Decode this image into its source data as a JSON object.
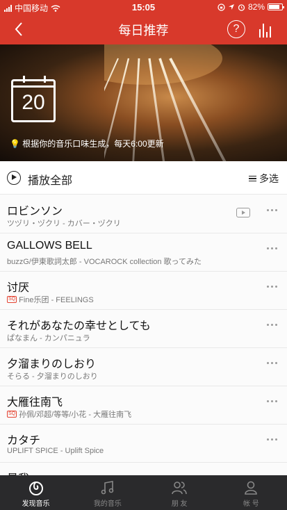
{
  "status": {
    "carrier": "中国移动",
    "time": "15:05",
    "battery": "82%"
  },
  "header": {
    "title": "每日推荐"
  },
  "hero": {
    "day": "20",
    "hint": "根据你的音乐口味生成，每天6:00更新"
  },
  "toolbar": {
    "play_all": "播放全部",
    "multi_select": "多选"
  },
  "songs": [
    {
      "title": "ロビンソン",
      "subtitle": "ツヅリ・ヅクリ - カバー・ヅクリ",
      "sq": false,
      "mv": true
    },
    {
      "title": "GALLOWS BELL",
      "subtitle": "buzzG/伊東歌詞太郎 - VOCAROCK collection 歌ってみた",
      "sq": false,
      "mv": false
    },
    {
      "title": "讨厌",
      "subtitle": "Fine乐团 - FEELINGS",
      "sq": true,
      "mv": false
    },
    {
      "title": "それがあなたの幸せとしても",
      "subtitle": "ぱなまん - カンパニュラ",
      "sq": false,
      "mv": false
    },
    {
      "title": "夕溜まりのしおり",
      "subtitle": "そらる - 夕溜まりのしおり",
      "sq": false,
      "mv": false
    },
    {
      "title": "大雁往南飞",
      "subtitle": "孙佩/邓超/等等/小花 - 大雁往南飞",
      "sq": true,
      "mv": false
    },
    {
      "title": "カタチ",
      "subtitle": "UPLIFT SPICE - Uplift Spice",
      "sq": false,
      "mv": false
    },
    {
      "title": "最我",
      "subtitle": "",
      "sq": false,
      "mv": false
    }
  ],
  "sq_badge": "SQ",
  "tabs": [
    {
      "label": "发现音乐",
      "icon": "netease-logo-icon",
      "active": true
    },
    {
      "label": "我的音乐",
      "icon": "music-note-icon",
      "active": false
    },
    {
      "label": "朋 友",
      "icon": "friends-icon",
      "active": false
    },
    {
      "label": "帐 号",
      "icon": "account-icon",
      "active": false
    }
  ],
  "colors": {
    "brand": "#d8392b",
    "tabbar": "#2a2a2c"
  }
}
